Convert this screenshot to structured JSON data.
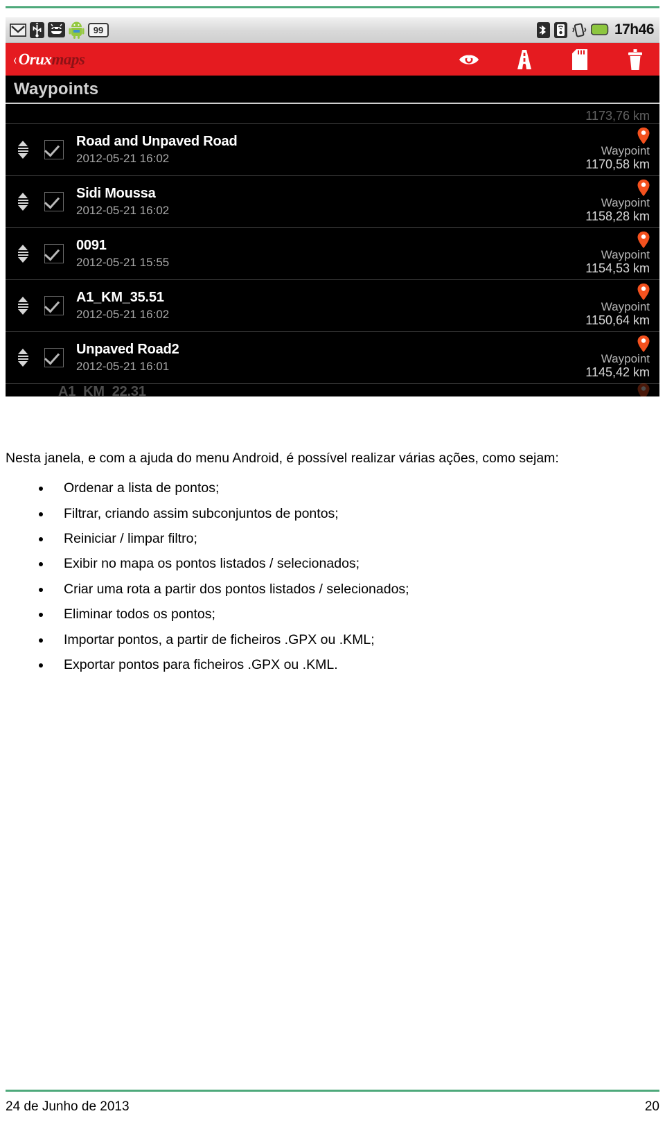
{
  "document": {
    "intro": "Nesta janela, e com a ajuda do menu Android, é possível realizar várias ações, como sejam:",
    "bullets": [
      "Ordenar a lista de pontos;",
      "Filtrar, criando assim subconjuntos de pontos;",
      "Reiniciar / limpar filtro;",
      "Exibir no mapa os pontos listados / selecionados;",
      "Criar uma rota a partir dos pontos listados / selecionados;",
      "Eliminar todos os pontos;",
      "Importar pontos, a partir de ficheiros .GPX ou .KML;",
      "Exportar pontos para ficheiros .GPX ou .KML."
    ],
    "footer": {
      "date": "24 de Junho de 2013",
      "page_number": "20"
    },
    "rule_color": "#4ea97b"
  },
  "screenshot": {
    "status_bar": {
      "icons": [
        "gmail-icon",
        "usb-icon",
        "android-debug-icon",
        "android-mascot-icon",
        "notification-count-badge"
      ],
      "notification_count": "99",
      "right_icons": [
        "bluetooth-icon",
        "signal-icon",
        "vibrate-icon",
        "battery-icon"
      ],
      "clock": "17h46"
    },
    "action_bar": {
      "logo_chevron": "‹",
      "logo_primary": "Orux",
      "logo_secondary": "maps",
      "background_color": "#e51b20",
      "icons": [
        {
          "name": "eye-icon",
          "label": "Exibir no mapa"
        },
        {
          "name": "route-icon",
          "label": "Criar rota"
        },
        {
          "name": "sdcard-icon",
          "label": "Importar / Exportar"
        },
        {
          "name": "trash-icon",
          "label": "Eliminar"
        }
      ]
    },
    "list_header": {
      "title": "Waypoints"
    },
    "waypoints": [
      {
        "name": "",
        "date": "",
        "type": "",
        "distance": "1173,76 km",
        "checked": true,
        "partial": "top"
      },
      {
        "name": "Road and Unpaved Road",
        "date": "2012-05-21 16:02",
        "type": "Waypoint",
        "distance": "1170,58 km",
        "checked": true,
        "partial": "none"
      },
      {
        "name": "Sidi Moussa",
        "date": "2012-05-21 16:02",
        "type": "Waypoint",
        "distance": "1158,28 km",
        "checked": true,
        "partial": "none"
      },
      {
        "name": "0091",
        "date": "2012-05-21 15:55",
        "type": "Waypoint",
        "distance": "1154,53 km",
        "checked": true,
        "partial": "none"
      },
      {
        "name": "A1_KM_35.51",
        "date": "2012-05-21 16:02",
        "type": "Waypoint",
        "distance": "1150,64 km",
        "checked": true,
        "partial": "none"
      },
      {
        "name": "Unpaved Road2",
        "date": "2012-05-21 16:01",
        "type": "Waypoint",
        "distance": "1145,42 km",
        "checked": true,
        "partial": "none"
      },
      {
        "name": "A1_KM_22.31",
        "date": "",
        "type": "",
        "distance": "",
        "checked": true,
        "partial": "bottom"
      }
    ],
    "colors": {
      "pin": "#f4511e",
      "background": "#000000",
      "accent_red": "#e51b20"
    }
  }
}
